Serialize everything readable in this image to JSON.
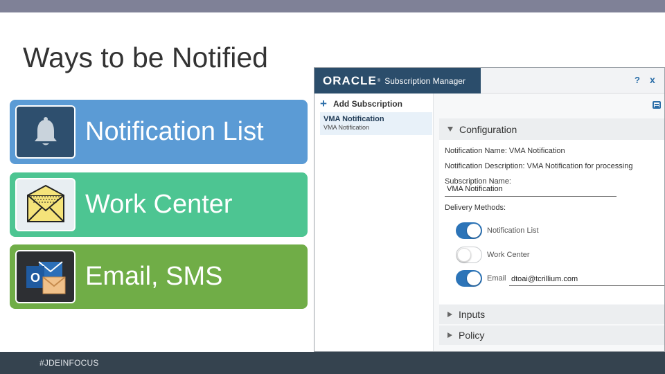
{
  "slide": {
    "title": "Ways to be Notified",
    "cards": [
      {
        "label": "Notification List",
        "icon": "bell-icon"
      },
      {
        "label": "Work Center",
        "icon": "envelope-icon"
      },
      {
        "label": "Email, SMS",
        "icon": "outlook-icon"
      }
    ],
    "footer": "#JDEINFOCUS"
  },
  "app": {
    "logo": "ORACLE",
    "logo_mark": "®",
    "product": "Subscription Manager",
    "help": "?",
    "close": "x",
    "add_subscription": "Add Subscription",
    "list": [
      {
        "title": "VMA Notification",
        "subtitle": "VMA Notification"
      }
    ],
    "config": {
      "heading": "Configuration",
      "notification_name": "Notification Name: VMA Notification",
      "notification_description": "Notification Description: VMA Notification for processing",
      "subscription_name_label": "Subscription Name:",
      "subscription_name_value": "VMA Notification",
      "delivery_methods_label": "Delivery Methods:",
      "methods": [
        {
          "label": "Notification List",
          "enabled": true
        },
        {
          "label": "Work Center",
          "enabled": false
        },
        {
          "label": "Email",
          "enabled": true,
          "value": "dtoai@tcrillium.com"
        }
      ]
    },
    "sections": [
      "Inputs",
      "Policy"
    ]
  },
  "colors": {
    "card_blue": "#5b9bd5",
    "card_teal": "#4dc592",
    "card_green": "#70ad47",
    "oracle_header": "#2b4d6b",
    "toggle_on": "#2c74b8",
    "footer": "#35434f"
  }
}
